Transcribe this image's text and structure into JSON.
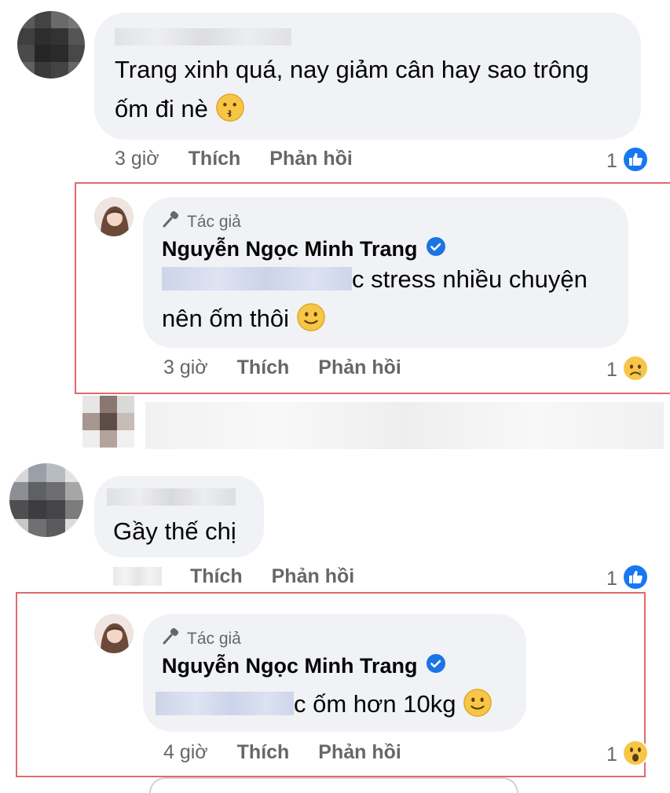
{
  "comments": [
    {
      "text_line1": "Trang xinh quá, nay giảm cân hay sao trông",
      "text_line2": "ốm đi nè",
      "time": "3 giờ",
      "like": "Thích",
      "reply": "Phản hồi",
      "reaction_count": "1",
      "reaction": "like-icon"
    },
    {
      "text": "Gầy thế chị",
      "like": "Thích",
      "reply": "Phản hồi",
      "reaction_count": "1",
      "reaction": "like-icon"
    }
  ],
  "replies": [
    {
      "badge": "Tác giả",
      "name": "Nguyễn Ngọc Minh Trang",
      "text_line1_visible": "c stress nhiều chuyện",
      "text_line2": "nên ốm thôi",
      "time": "3 giờ",
      "like": "Thích",
      "reply": "Phản hồi",
      "reaction_count": "1",
      "reaction": "sad-icon"
    },
    {
      "badge": "Tác giả",
      "name": "Nguyễn Ngọc Minh Trang",
      "text_visible": "c ốm hơn 10kg",
      "time": "4 giờ",
      "like": "Thích",
      "reply": "Phản hồi",
      "reaction_count": "1",
      "reaction": "wow-icon"
    }
  ],
  "colors": {
    "bubble": "#f0f2f5",
    "like_blue": "#1877f2",
    "verified": "#1b74e4",
    "highlight_border": "#e06a6a",
    "meta_gray": "#65676b"
  }
}
